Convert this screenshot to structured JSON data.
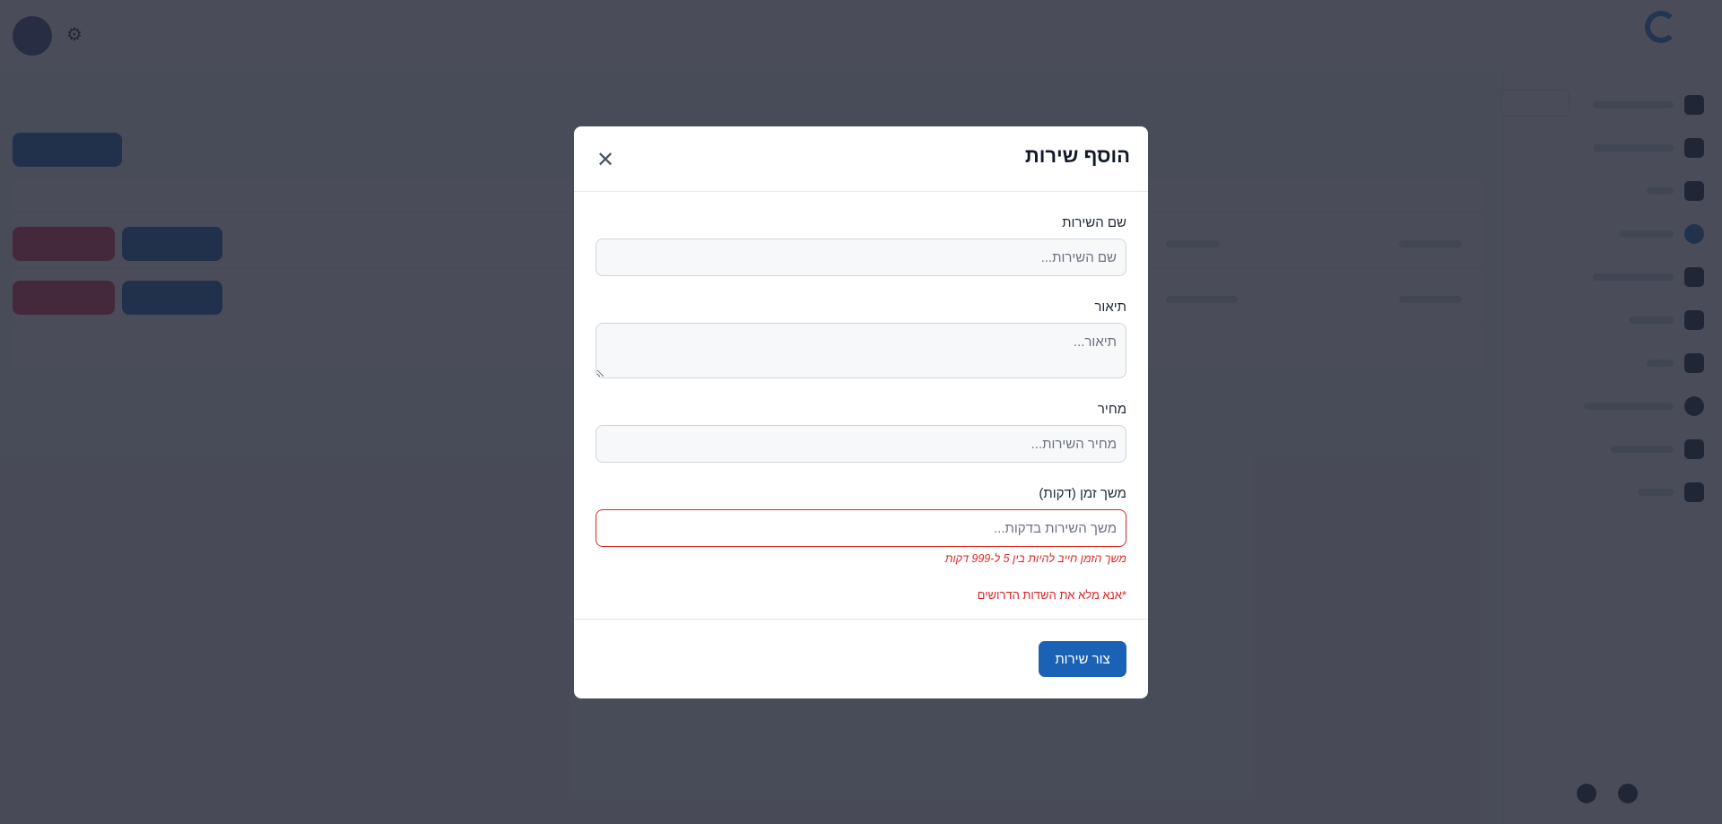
{
  "modal": {
    "title": "הוסף שירות",
    "fields": [
      {
        "label": "שם השירות",
        "placeholder": "שם השירות...",
        "value": ""
      },
      {
        "label": "תיאור",
        "placeholder": "תיאור...",
        "value": ""
      },
      {
        "label": "מחיר",
        "placeholder": "מחיר השירות...",
        "value": ""
      },
      {
        "label": "משך זמן (דקות)",
        "placeholder": "משך השירות בדקות...",
        "value": "",
        "error": "משך הזמן חייב להיות בין 5 ל-999 דקות"
      }
    ],
    "required_note": "*אנא מלא את השדות הדרושים",
    "submit_label": "צור שירות"
  },
  "colors": {
    "primary": "#1a62b5",
    "error": "#dc2626",
    "overlay": "rgba(34,38,52,0.82)"
  }
}
